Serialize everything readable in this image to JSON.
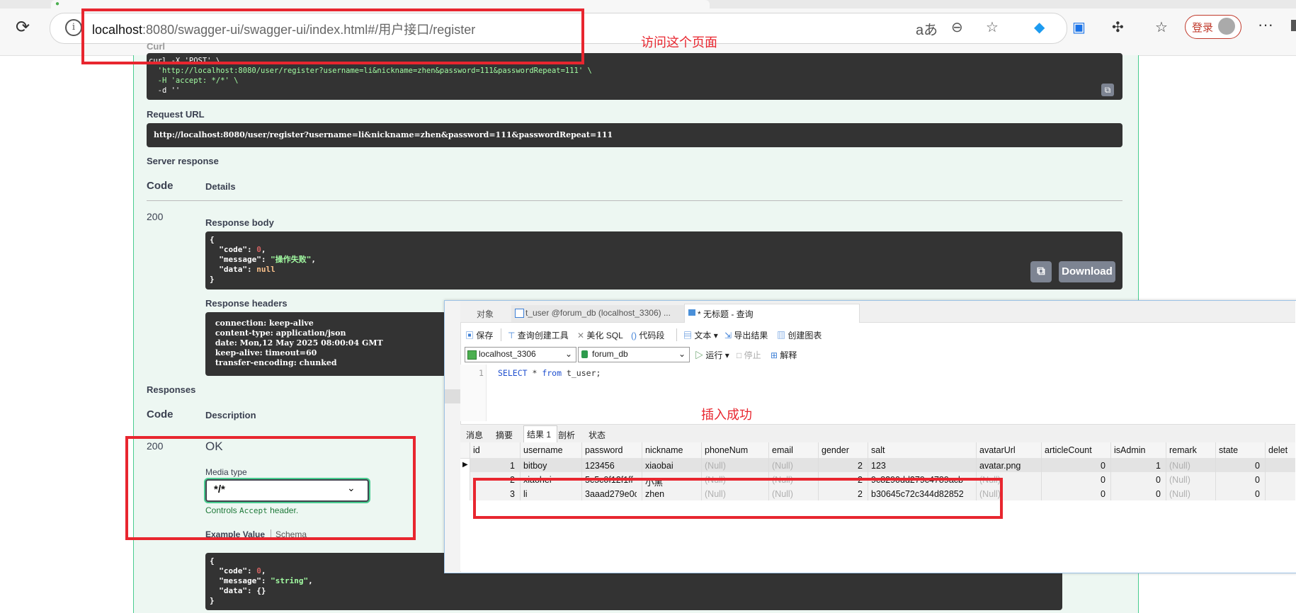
{
  "browser": {
    "url_host": "localhost",
    "url_rest": ":8080/swagger-ui/swagger-ui/index.html#/用户接口/register",
    "login_label": "登录",
    "read_aloud_glyph": "aあ"
  },
  "annotations": {
    "visit_page": "访问这个页面",
    "insert_success": "插入成功"
  },
  "swagger": {
    "curl_label": "Curl",
    "curl_lines": [
      "curl -X 'POST' \\",
      "  'http://localhost:8080/user/register?username=li&nickname=zhen&password=111&passwordRepeat=111' \\",
      "  -H 'accept: */*' \\",
      "  -d ''"
    ],
    "request_url_label": "Request URL",
    "request_url": "http://localhost:8080/user/register?username=li&nickname=zhen&password=111&passwordRepeat=111",
    "server_response_label": "Server response",
    "code_header": "Code",
    "details_header": "Details",
    "response_code": "200",
    "response_body_label": "Response body",
    "response_body": {
      "open": "{",
      "code_key": "  \"code\": ",
      "code_val": "0",
      "message_key": "  \"message\": ",
      "message_val": "\"操作失败\"",
      "data_key": "  \"data\": ",
      "data_val": "null",
      "close": "}"
    },
    "download_label": "Download",
    "response_headers_label": "Response headers",
    "response_headers": [
      " connection: keep-alive",
      " content-type: application/json",
      " date: Mon,12 May 2025 08:00:04 GMT",
      " keep-alive: timeout=60",
      " transfer-encoding: chunked"
    ],
    "responses_label": "Responses",
    "code_header2": "Code",
    "description_header": "Description",
    "ok_code": "200",
    "ok_desc": "OK",
    "media_type_label": "Media type",
    "media_type_value": "*/*",
    "controls_prefix": "Controls ",
    "controls_code": "Accept",
    "controls_suffix": " header.",
    "example_value_tab": "Example Value",
    "schema_tab": "Schema",
    "example": {
      "open": "{",
      "code_key": "  \"code\": ",
      "code_val": "0",
      "message_key": "  \"message\": ",
      "message_val": "\"string\"",
      "data_key": "  \"data\": ",
      "data_val": "{}",
      "close": "}"
    }
  },
  "navicat": {
    "tabs": [
      "对象",
      "t_user @forum_db (localhost_3306) ...",
      "* 无标题 - 查询"
    ],
    "toolbar": [
      "保存",
      "查询创建工具",
      "美化 SQL",
      "代码段",
      "文本",
      "导出结果",
      "创建图表"
    ],
    "connection": "localhost_3306",
    "database": "forum_db",
    "run_label": "运行",
    "stop_label": "停止",
    "explain_label": "解释",
    "line_no": "1",
    "sql_kw1": "SELECT",
    "sql_mid": " * ",
    "sql_kw2": "from",
    "sql_tail": " t_user;",
    "result_tabs": [
      "消息",
      "摘要",
      "结果 1",
      "剖析",
      "状态"
    ],
    "columns": [
      "id",
      "username",
      "password",
      "nickname",
      "phoneNum",
      "email",
      "gender",
      "salt",
      "avatarUrl",
      "articleCount",
      "isAdmin",
      "remark",
      "state",
      "delet"
    ],
    "rows": [
      [
        "1",
        "bitboy",
        "123456",
        "xiaobai",
        "(Null)",
        "(Null)",
        "2",
        "123",
        "avatar.png",
        "0",
        "1",
        "(Null)",
        "0",
        ""
      ],
      [
        "2",
        "xiaohei",
        "5c5c0f12f1ff",
        "小黑",
        "(Null)",
        "(Null)",
        "2",
        "9c8290dd279c4789acb",
        "(Null)",
        "0",
        "0",
        "(Null)",
        "0",
        ""
      ],
      [
        "3",
        "li",
        "3aaad279e0c",
        "zhen",
        "(Null)",
        "(Null)",
        "2",
        "b30645c72c344d82852",
        "(Null)",
        "0",
        "0",
        "(Null)",
        "0",
        ""
      ]
    ]
  },
  "colors": {
    "accent_red": "#e8262f",
    "swagger_green": "#49cc90"
  }
}
